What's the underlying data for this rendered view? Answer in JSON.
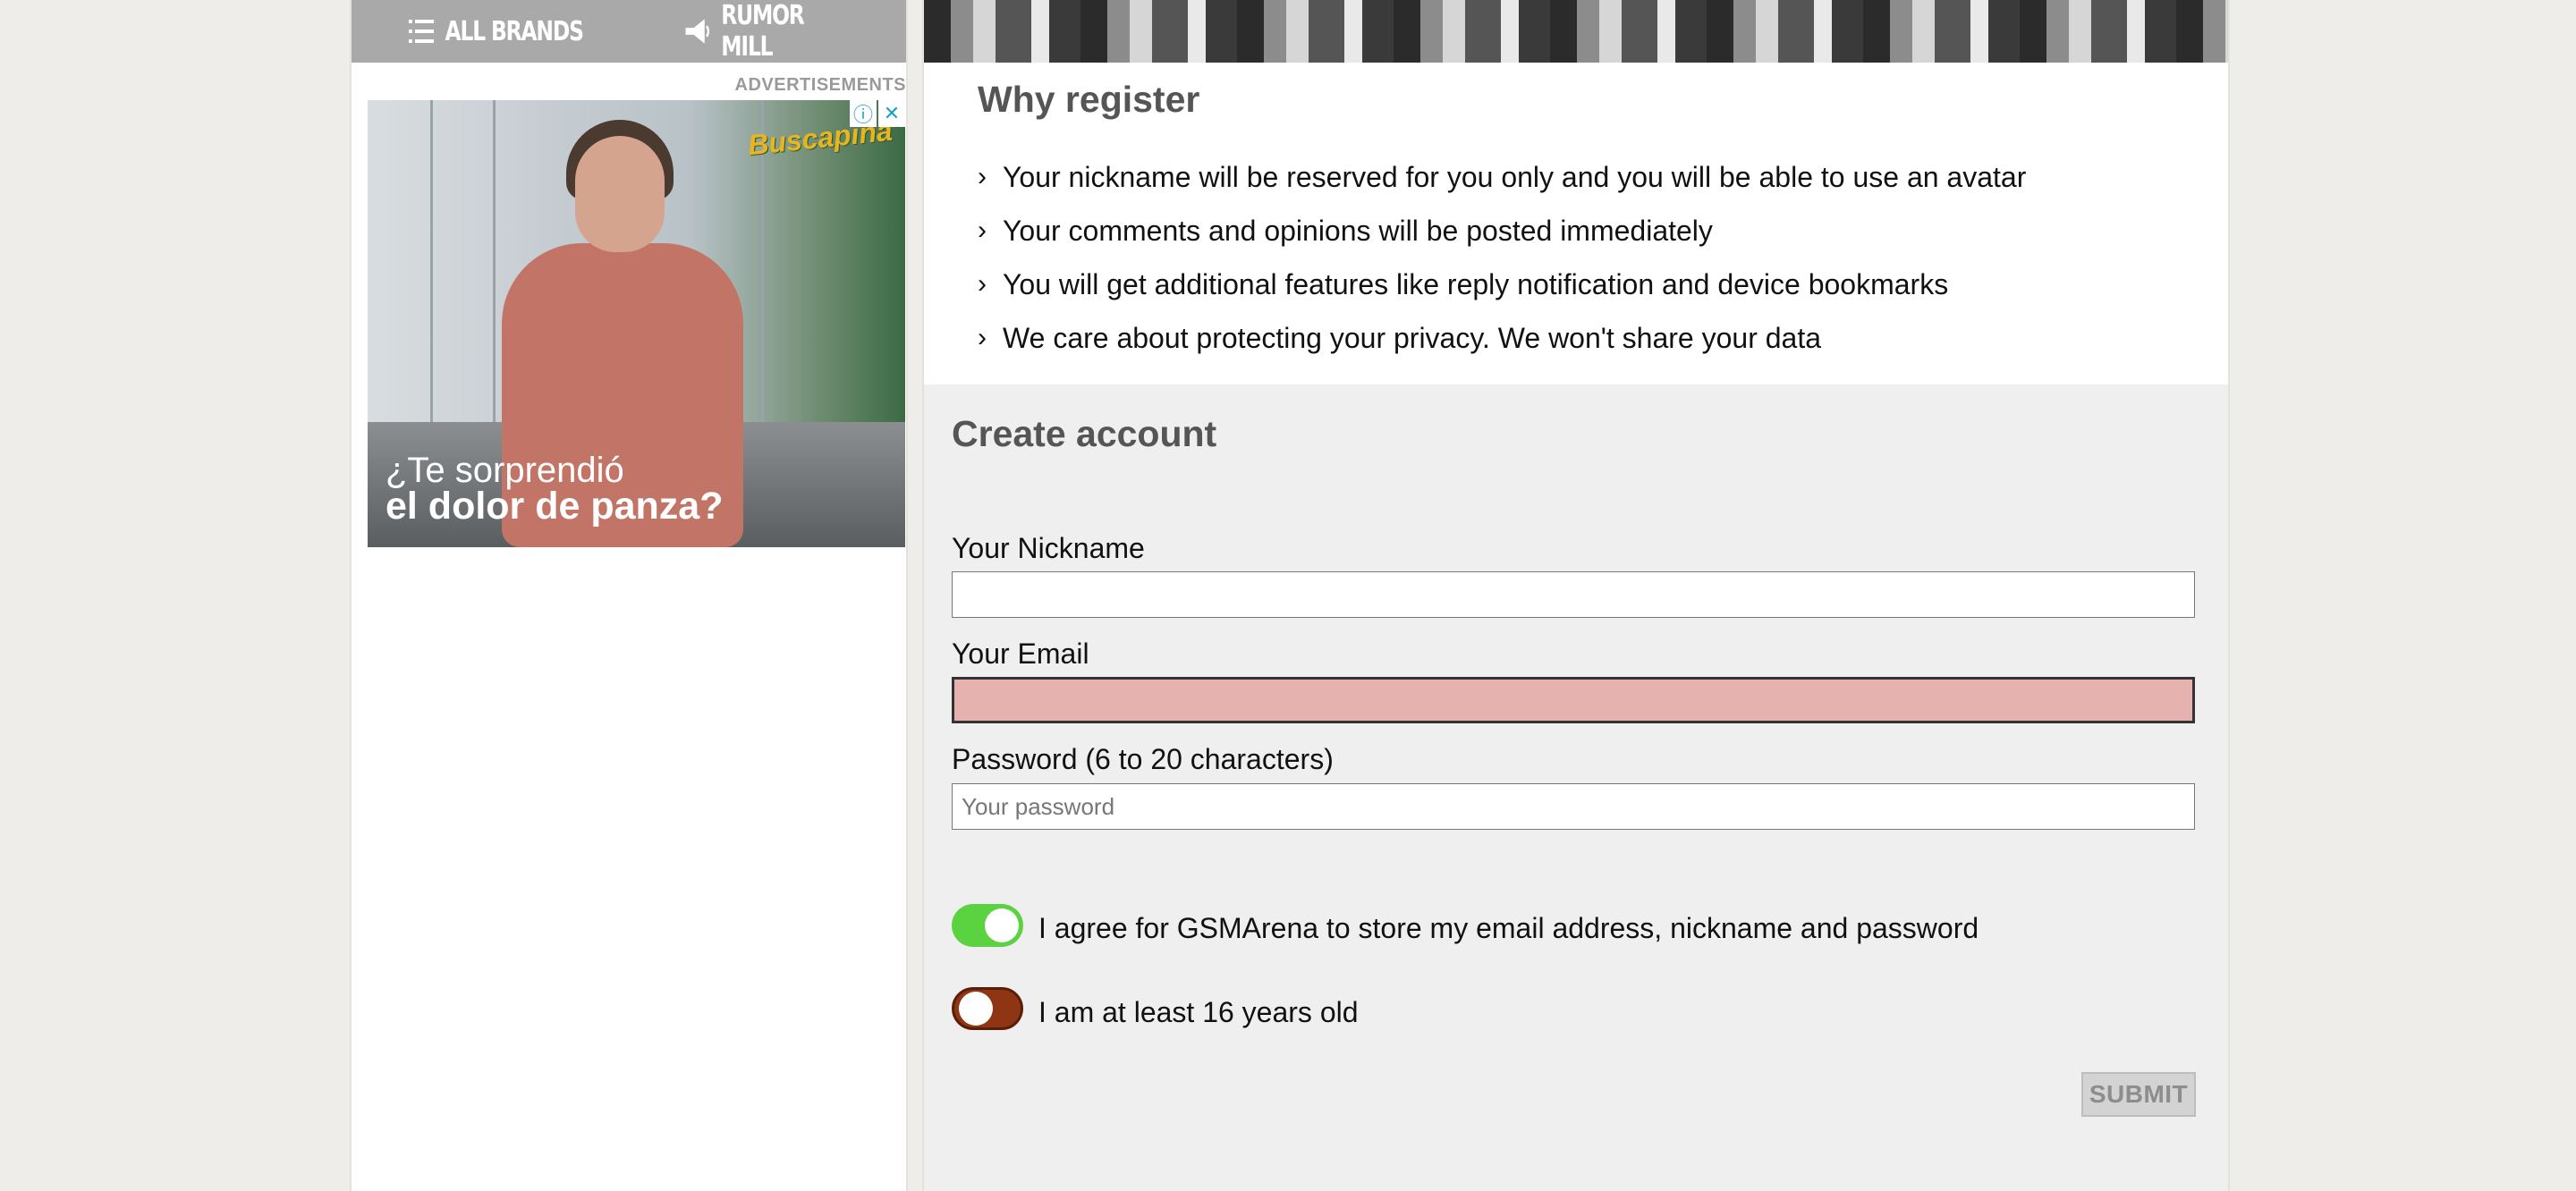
{
  "nav": {
    "all_brands": "ALL BRANDS",
    "rumor_mill": "RUMOR MILL"
  },
  "ads": {
    "label": "ADVERTISEMENTS",
    "brand": "Buscapina",
    "line1": "¿Te sorprendió",
    "line2": "el dolor de panza?",
    "info_icon": "ⓘ",
    "close_icon": "✕"
  },
  "why": {
    "title": "Why register",
    "items": [
      "Your nickname will be reserved for you only and you will be able to use an avatar",
      "Your comments and opinions will be posted immediately",
      "You will get additional features like reply notification and device bookmarks",
      "We care about protecting your privacy. We won't share your data"
    ]
  },
  "form": {
    "title": "Create account",
    "nickname_label": "Your Nickname",
    "nickname_value": "",
    "email_label": "Your Email",
    "email_value": "",
    "password_label": "Password (6 to 20 characters)",
    "password_placeholder": "Your password",
    "agree_text": "I agree for GSMArena to store my email address, nickname and password",
    "agree_on": true,
    "age_text": "I am at least 16 years old",
    "age_on": false,
    "submit_label": "SUBMIT"
  },
  "colors": {
    "toggle_on": "#5bd341",
    "toggle_off": "#8e3614",
    "email_error_bg": "#e5b2b0"
  }
}
